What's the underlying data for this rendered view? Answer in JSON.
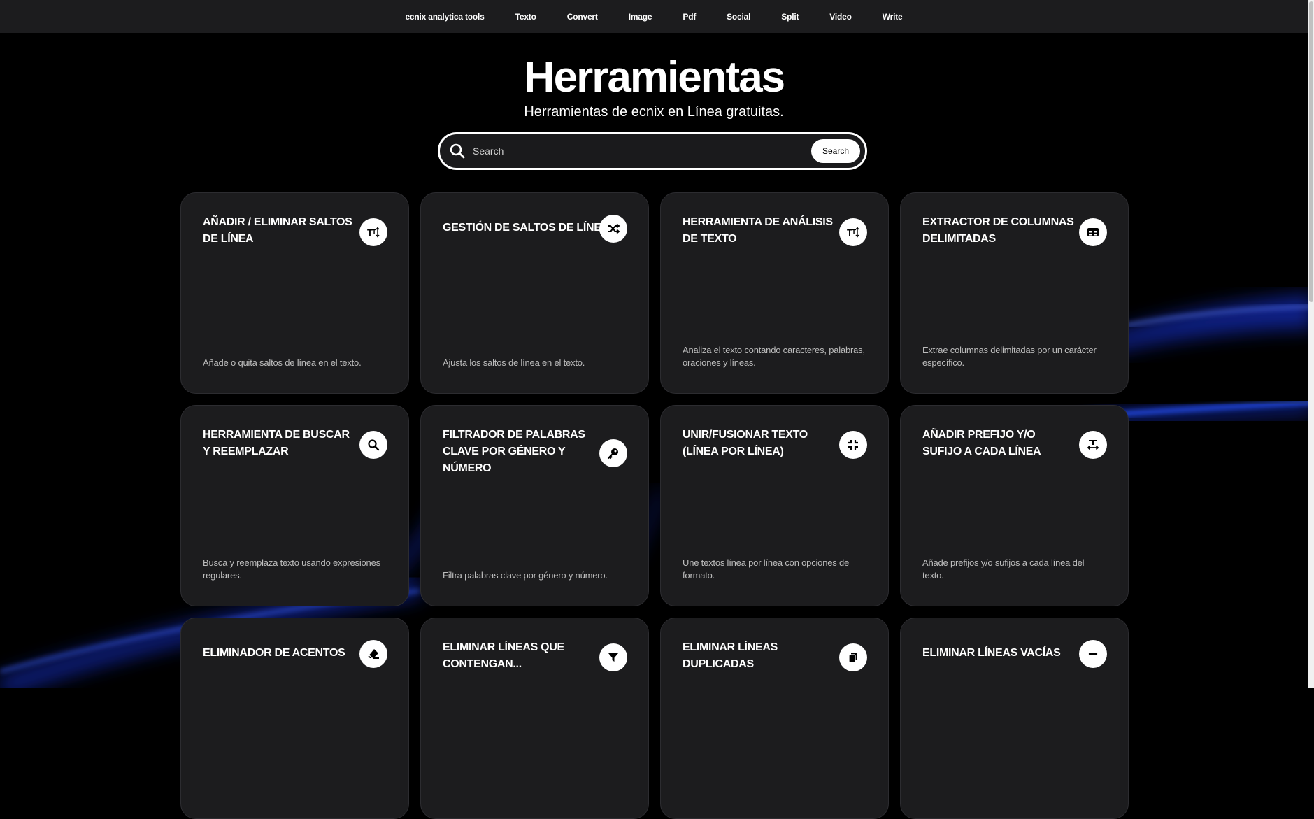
{
  "nav": {
    "items": [
      {
        "label": "ecnix analytica tools"
      },
      {
        "label": "Texto"
      },
      {
        "label": "Convert"
      },
      {
        "label": "Image"
      },
      {
        "label": "Pdf"
      },
      {
        "label": "Social"
      },
      {
        "label": "Split"
      },
      {
        "label": "Video"
      },
      {
        "label": "Write"
      }
    ]
  },
  "hero": {
    "title": "Herramientas",
    "subtitle": "Herramientas de ecnix en Línea gratuitas."
  },
  "search": {
    "placeholder": "Search",
    "value": "",
    "button_label": "Search"
  },
  "cards": [
    {
      "title": "Añadir / Eliminar saltos de línea",
      "desc": "Añade o quita saltos de línea en el texto.",
      "icon": "text-height-icon"
    },
    {
      "title": "Gestión de saltos de línea",
      "desc": "Ajusta los saltos de línea en el texto.",
      "icon": "shuffle-icon"
    },
    {
      "title": "Herramienta de análisis de texto",
      "desc": "Analiza el texto contando caracteres, palabras, oraciones y líneas.",
      "icon": "text-height-icon"
    },
    {
      "title": "Extractor de columnas delimitadas",
      "desc": "Extrae columnas delimitadas por un carácter específico.",
      "icon": "table-icon"
    },
    {
      "title": "Herramienta de buscar y reemplazar",
      "desc": "Busca y reemplaza texto usando expresiones regulares.",
      "icon": "search-icon"
    },
    {
      "title": "Filtrador de palabras clave por género y número",
      "desc": "Filtra palabras clave por género y número.",
      "icon": "key-icon"
    },
    {
      "title": "Unir/Fusionar texto (línea por línea)",
      "desc": "Une textos línea por línea con opciones de formato.",
      "icon": "compress-icon"
    },
    {
      "title": "Añadir prefijo y/o sufijo a cada línea",
      "desc": "Añade prefijos y/o sufijos a cada línea del texto.",
      "icon": "text-width-icon"
    },
    {
      "title": "Eliminador de acentos",
      "desc": "",
      "icon": "eraser-icon"
    },
    {
      "title": "Eliminar líneas que contengan...",
      "desc": "",
      "icon": "filter-icon"
    },
    {
      "title": "Eliminar líneas duplicadas",
      "desc": "",
      "icon": "copy-icon"
    },
    {
      "title": "Eliminar líneas vacías",
      "desc": "",
      "icon": "minus-icon"
    }
  ],
  "colors": {
    "background": "#000000",
    "card": "#1c1c1e",
    "accent_glow": "#1f4bff"
  }
}
